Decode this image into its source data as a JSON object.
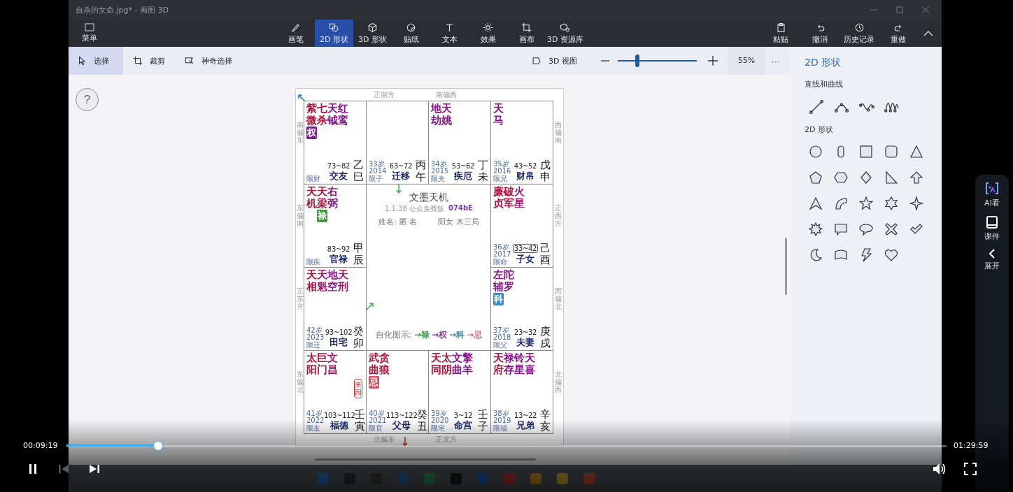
{
  "window": {
    "title": "自杀的女命.jpg* - 画图 3D",
    "menu_label": "菜单",
    "tools": [
      {
        "label": "画笔",
        "selected": false
      },
      {
        "label": "2D 形状",
        "selected": true
      },
      {
        "label": "3D 形状",
        "selected": false
      },
      {
        "label": "贴纸",
        "selected": false
      },
      {
        "label": "文本",
        "selected": false
      },
      {
        "label": "效果",
        "selected": false
      },
      {
        "label": "画布",
        "selected": false
      },
      {
        "label": "3D 资源库",
        "selected": false
      }
    ],
    "actions": [
      "粘贴",
      "撤消",
      "历史记录",
      "重做"
    ]
  },
  "subtoolbar": {
    "selection_tools": [
      {
        "label": "选择",
        "selected": true
      },
      {
        "label": "裁剪",
        "selected": false
      },
      {
        "label": "神奇选择",
        "selected": false
      }
    ],
    "view_3d": "3D 视图",
    "zoom": {
      "level": 0.25,
      "reading": "55%"
    },
    "more": "···"
  },
  "help": "?",
  "chart": {
    "directions": {
      "top": [
        "正南方",
        "南偏西"
      ],
      "left": [
        "南偏东",
        "东偏南",
        "正东方",
        "东偏北"
      ],
      "right": [
        "西偏南",
        "正西方",
        "西偏北",
        "北偏西"
      ],
      "bottom": [
        "北偏东",
        "正北方"
      ]
    },
    "palaces": [
      {
        "stars": [
          {
            "name": "紫微",
            "color": "#b0123c",
            "hua": {
              "text": "权",
              "color": "#7a1f8f"
            }
          },
          {
            "name": "七杀",
            "color": "#b0123c"
          },
          {
            "name": "天钺",
            "color": "#86168a"
          },
          {
            "name": "红鸾",
            "color": "#86168a"
          }
        ],
        "limit": "限财",
        "range": "73~82",
        "range_highlighted": false,
        "name": "交友",
        "ganzhi": "乙巳"
      },
      {
        "age": "33岁",
        "year": "2014",
        "limit": "限子",
        "range": "63~72",
        "range_highlighted": false,
        "name": "迁移",
        "ganzhi": "丙午"
      },
      {
        "stars": [
          {
            "name": "地劫",
            "color": "#86168a"
          },
          {
            "name": "天姚",
            "color": "#86168a"
          }
        ],
        "age": "34岁",
        "year": "2015",
        "limit": "限夫",
        "range": "53~62",
        "range_highlighted": false,
        "name": "疾厄",
        "ganzhi": "丁未"
      },
      {
        "stars": [
          {
            "name": "天马",
            "color": "#86168a"
          }
        ],
        "age": "35岁",
        "year": "2016",
        "limit": "限兄",
        "range": "43~52",
        "range_highlighted": false,
        "name": "财帛",
        "ganzhi": "戊申"
      },
      {
        "stars": [
          {
            "name": "天机",
            "color": "#b0123c"
          },
          {
            "name": "天梁",
            "color": "#b0123c",
            "hua": {
              "text": "禄",
              "color": "#3c9a3c"
            }
          },
          {
            "name": "右弼",
            "color": "#86168a"
          }
        ],
        "limit": "限疾",
        "range": "83~92",
        "range_highlighted": false,
        "name": "官禄",
        "ganzhi": "甲辰"
      },
      {
        "stars": [
          {
            "name": "廉贞",
            "color": "#b0123c"
          },
          {
            "name": "破军",
            "color": "#b0123c"
          },
          {
            "name": "火星",
            "color": "#a0186a"
          }
        ],
        "age": "36岁",
        "year": "2017",
        "limit": "限命",
        "range": "33~42",
        "range_highlighted": true,
        "name": "子女",
        "ganzhi": "己酉"
      },
      {
        "stars": [
          {
            "name": "天相",
            "color": "#b0123c"
          },
          {
            "name": "天魁",
            "color": "#a0186a"
          },
          {
            "name": "地空",
            "color": "#86168a"
          },
          {
            "name": "天刑",
            "color": "#a0186a"
          }
        ],
        "age": "42岁",
        "year": "2023",
        "limit": "限迁",
        "range": "93~102",
        "range_highlighted": false,
        "name": "田宅",
        "ganzhi": "癸卯"
      },
      {
        "stars": [
          {
            "name": "左辅",
            "color": "#86168a",
            "hua": {
              "text": "科",
              "color": "#3b88d0"
            }
          },
          {
            "name": "陀罗",
            "color": "#86168a"
          }
        ],
        "age": "37岁",
        "year": "2018",
        "limit": "限父",
        "range": "23~32",
        "range_highlighted": false,
        "name": "夫妻",
        "ganzhi": "庚戌"
      },
      {
        "stars": [
          {
            "name": "太阳",
            "color": "#b0123c"
          },
          {
            "name": "巨门",
            "color": "#b0123c"
          },
          {
            "name": "文昌",
            "color": "#a0186a"
          }
        ],
        "stamp": "来因",
        "age": "41岁",
        "year": "2022",
        "limit": "限友",
        "range": "103~112",
        "range_highlighted": false,
        "name": "福德",
        "ganzhi": "壬寅"
      },
      {
        "stars": [
          {
            "name": "武曲",
            "color": "#b0123c",
            "hua": {
              "text": "忌",
              "color": "#e04a5a"
            }
          },
          {
            "name": "贪狼",
            "color": "#b0123c"
          }
        ],
        "age": "40岁",
        "year": "2021",
        "limit": "限官",
        "range": "113~122",
        "range_highlighted": false,
        "name": "父母",
        "ganzhi": "癸丑"
      },
      {
        "stars": [
          {
            "name": "天同",
            "color": "#b0123c"
          },
          {
            "name": "太阴",
            "color": "#b0123c"
          },
          {
            "name": "文曲",
            "color": "#86168a"
          },
          {
            "name": "擎羊",
            "color": "#86168a"
          }
        ],
        "age": "39岁",
        "year": "2020",
        "limit": "限宅",
        "range": "3~12",
        "range_highlighted": false,
        "name": "命宫",
        "ganzhi": "壬子"
      },
      {
        "stars": [
          {
            "name": "天府",
            "color": "#b0123c"
          },
          {
            "name": "禄存",
            "color": "#86168a"
          },
          {
            "name": "铃星",
            "color": "#86168a"
          },
          {
            "name": "天喜",
            "color": "#86168a"
          }
        ],
        "age": "38岁",
        "year": "2019",
        "limit": "限福",
        "range": "13~22",
        "range_highlighted": false,
        "name": "兄弟",
        "ganzhi": "辛亥"
      }
    ],
    "center": {
      "title": "文墨天机",
      "version": "1.1.38 公众免费版",
      "code": "074bE",
      "name_line": "姓名: 匿 名",
      "info": "阳女 木三局",
      "legend_label": "自化图示:",
      "legend": [
        {
          "text": "→禄",
          "color": "#3c9a4a"
        },
        {
          "text": "→权",
          "color": "#8a3a9a"
        },
        {
          "text": "→科",
          "color": "#3a8aa0"
        },
        {
          "text": "→忌",
          "color": "#d07080"
        }
      ]
    }
  },
  "side_panel": {
    "title": "2D 形状",
    "sections": [
      {
        "heading": "直线和曲线",
        "kind": "lines"
      },
      {
        "heading": "2D 形状",
        "kind": "shapes"
      }
    ]
  },
  "side_widget": [
    {
      "label": "AI看",
      "kind": "ai"
    },
    {
      "label": "课件",
      "kind": "courseware"
    },
    {
      "label": "展开",
      "kind": "expand"
    }
  ],
  "player": {
    "elapsed": "00:09:19",
    "duration": "01:29:59",
    "progress": {
      "level": 0.104
    },
    "controls": [
      {
        "kind": "pause",
        "disabled": false
      },
      {
        "kind": "previous",
        "disabled": true
      },
      {
        "kind": "next",
        "disabled": false
      }
    ],
    "right_controls": [
      {
        "kind": "volume"
      },
      {
        "kind": "fullscreen"
      }
    ]
  }
}
